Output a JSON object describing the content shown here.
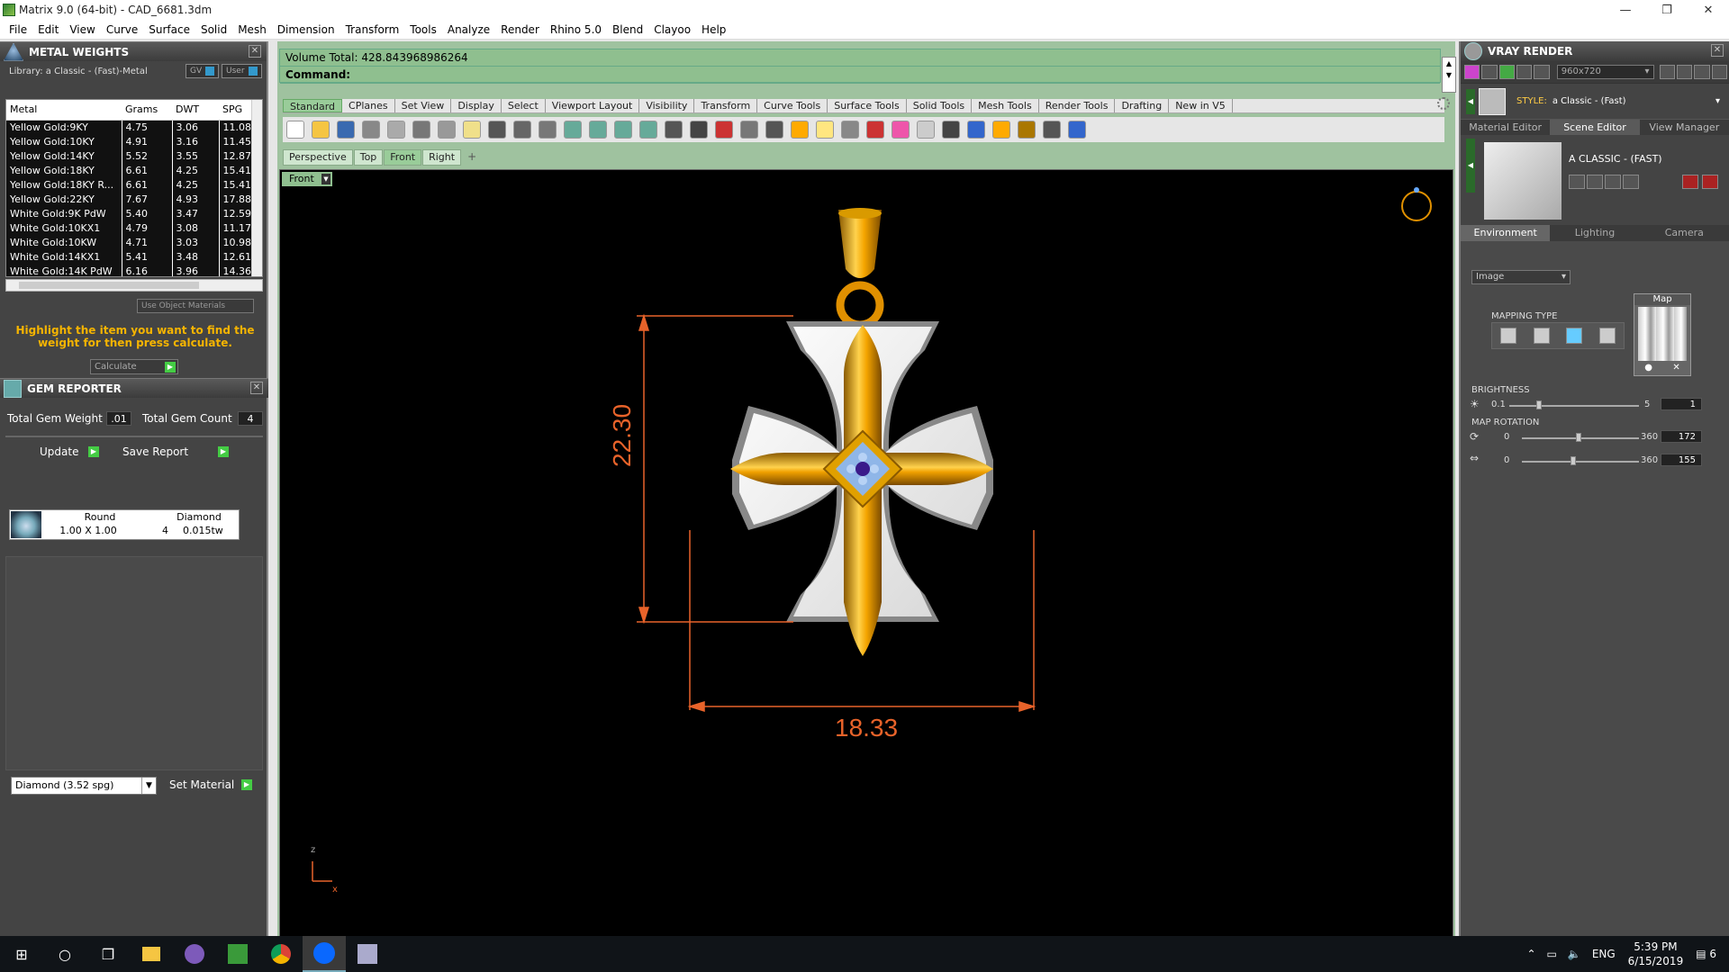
{
  "window": {
    "title": "Matrix 9.0 (64-bit) - CAD_6681.3dm",
    "minimize": "—",
    "maximize": "❐",
    "close": "✕"
  },
  "menu": [
    "File",
    "Edit",
    "View",
    "Curve",
    "Surface",
    "Solid",
    "Mesh",
    "Dimension",
    "Transform",
    "Tools",
    "Analyze",
    "Render",
    "Rhino 5.0",
    "Blend",
    "Clayoo",
    "Help"
  ],
  "metal_weights": {
    "title": "METAL WEIGHTS",
    "library": "Library: a Classic - (Fast)-Metal",
    "btn_gv": "GV",
    "btn_user": "User",
    "columns": [
      "Metal",
      "Grams",
      "DWT",
      "SPG"
    ],
    "rows": [
      [
        "Yellow Gold:9KY",
        "4.75",
        "3.06",
        "11.08"
      ],
      [
        "Yellow Gold:10KY",
        "4.91",
        "3.16",
        "11.45"
      ],
      [
        "Yellow Gold:14KY",
        "5.52",
        "3.55",
        "12.87"
      ],
      [
        "Yellow Gold:18KY",
        "6.61",
        "4.25",
        "15.41"
      ],
      [
        "Yellow Gold:18KY R...",
        "6.61",
        "4.25",
        "15.41"
      ],
      [
        "Yellow Gold:22KY",
        "7.67",
        "4.93",
        "17.88"
      ],
      [
        "White Gold:9K PdW",
        "5.40",
        "3.47",
        "12.59"
      ],
      [
        "White Gold:10KX1",
        "4.79",
        "3.08",
        "11.17"
      ],
      [
        "White Gold:10KW",
        "4.71",
        "3.03",
        "10.98"
      ],
      [
        "White Gold:14KX1",
        "5.41",
        "3.48",
        "12.61"
      ],
      [
        "White Gold:14K PdW",
        "6.16",
        "3.96",
        "14.36"
      ]
    ],
    "use_object_materials": "Use Object Materials",
    "hint": "Highlight the item you want to find the weight for then press calculate.",
    "calculate": "Calculate"
  },
  "gem_reporter": {
    "title": "GEM REPORTER",
    "total_weight_label": "Total Gem Weight",
    "total_weight": ".01",
    "total_count_label": "Total Gem Count",
    "total_count": "4",
    "update": "Update",
    "save_report": "Save Report",
    "columns": [
      "Round",
      "Diamond"
    ],
    "row": {
      "size": "1.00 X 1.00",
      "count": "4",
      "weight": "0.015tw"
    },
    "material": "Diamond    (3.52 spg)",
    "set_material": "Set Material"
  },
  "command": {
    "volume": "Volume Total: 428.843968986264",
    "label": "Command:"
  },
  "tabs": [
    "Standard",
    "CPlanes",
    "Set View",
    "Display",
    "Select",
    "Viewport Layout",
    "Visibility",
    "Transform",
    "Curve Tools",
    "Surface Tools",
    "Solid Tools",
    "Mesh Tools",
    "Render Tools",
    "Drafting",
    "New in V5"
  ],
  "toolbar_icons": [
    "new-file-icon",
    "open-icon",
    "save-icon",
    "print-icon",
    "import-icon",
    "cut-icon",
    "copy-icon",
    "paste-icon",
    "undo-icon",
    "pan-icon",
    "move-icon",
    "zoom-icon",
    "zoom-window-icon",
    "zoom-extents-icon",
    "zoom-selected-icon",
    "rotate-view-icon",
    "grid-icon",
    "car-icon",
    "select-icon",
    "orbit-icon",
    "points-icon",
    "light-icon",
    "lock-icon",
    "layer-icon",
    "color-icon",
    "shade-icon",
    "render-icon",
    "sphere-icon",
    "filter-icon",
    "gear-tool-icon",
    "snap-icon",
    "help-icon"
  ],
  "viewport_tabs": [
    "Perspective",
    "Top",
    "Front",
    "Right"
  ],
  "viewport_add": "+",
  "viewport": {
    "name": "Front",
    "dim_height": "22.30",
    "dim_width": "18.33",
    "axis_z": "z",
    "axis_x": "x"
  },
  "vray": {
    "title": "VRAY RENDER",
    "resolution": "960x720",
    "style_label": "STYLE:",
    "style_value": "a Classic - (Fast)",
    "editor_tabs": [
      "Material Editor",
      "Scene Editor",
      "View Manager"
    ],
    "scene_name": "A CLASSIC - (FAST)",
    "env_tabs": [
      "Environment",
      "Lighting",
      "Camera"
    ],
    "env_type": "Image",
    "mapping_type": "MAPPING TYPE",
    "map_label": "Map",
    "brightness_label": "BRIGHTNESS",
    "brightness_min": "0.1",
    "brightness_max": "5",
    "brightness_value": "1",
    "map_rotation_label": "MAP ROTATION",
    "rot1_min": "0",
    "rot1_max": "360",
    "rot1_value": "172",
    "rot2_min": "0",
    "rot2_max": "360",
    "rot2_value": "155"
  },
  "taskbar": {
    "lang": "ENG",
    "time": "5:39 PM",
    "date": "6/15/2019",
    "notif": "6"
  },
  "colors": {
    "accent_green": "#9c9",
    "dimension_orange": "#e8632a",
    "hint_yellow": "#f5b400"
  }
}
